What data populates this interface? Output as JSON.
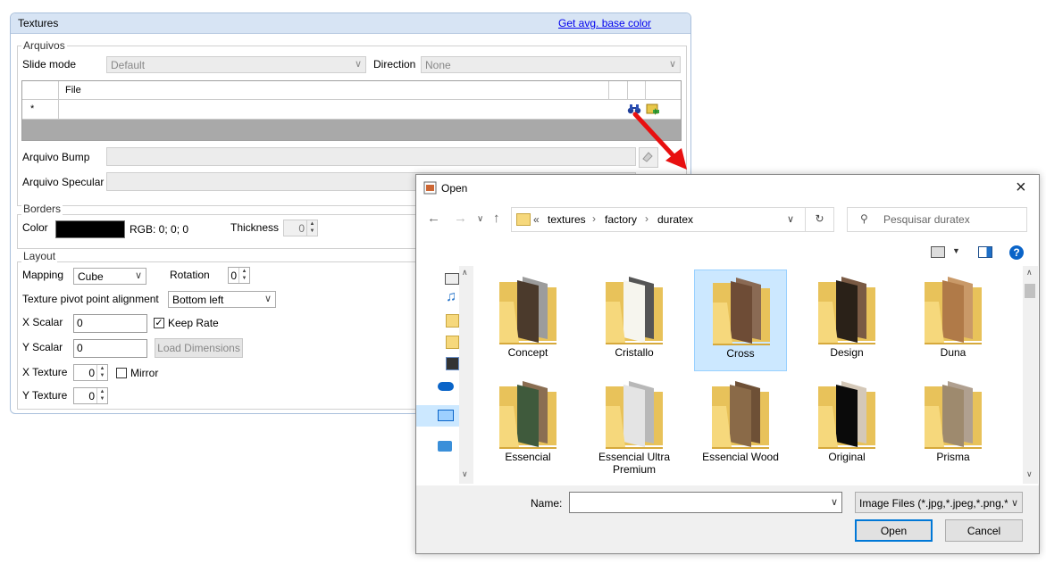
{
  "textures": {
    "title": "Textures",
    "avg_link": "Get avg. base color",
    "arquivos": {
      "group_label": "Arquivos",
      "slide_mode_label": "Slide mode",
      "slide_mode_value": "Default",
      "direction_label": "Direction",
      "direction_value": "None",
      "grid": {
        "col_file": "File",
        "new_row_marker": "*"
      },
      "bump_label": "Arquivo Bump",
      "specular_label": "Arquivo Specular"
    },
    "borders": {
      "group_label": "Borders",
      "color_label": "Color",
      "color_swatch": "#000000",
      "rgb_text": "RGB: 0; 0; 0",
      "thickness_label": "Thickness",
      "thickness_value": "0"
    },
    "layout": {
      "group_label": "Layout",
      "mapping_label": "Mapping",
      "mapping_value": "Cube",
      "rotation_label": "Rotation",
      "rotation_value": "0",
      "pivot_label": "Texture pivot point alignment",
      "pivot_value": "Bottom left",
      "xscalar_label": "X Scalar",
      "xscalar_value": "0",
      "keep_rate_label": "Keep Rate",
      "yscalar_label": "Y Scalar",
      "yscalar_value": "0",
      "load_dims_label": "Load Dimensions",
      "xtexture_label": "X Texture",
      "xtexture_value": "0",
      "mirror_label": "Mirror",
      "ytexture_label": "Y Texture",
      "ytexture_value": "0"
    }
  },
  "dialog": {
    "title": "Open",
    "breadcrumb": [
      "textures",
      "factory",
      "duratex"
    ],
    "breadcrumb_prefix": "«",
    "search_placeholder": "Pesquisar duratex",
    "folders": [
      {
        "name": "Concept",
        "colors": [
          "#4b3a2c",
          "#9c9c9c"
        ]
      },
      {
        "name": "Cristallo",
        "colors": [
          "#f6f5ee",
          "#555555"
        ]
      },
      {
        "name": "Cross",
        "colors": [
          "#6e4c36",
          "#8a6a54"
        ],
        "selected": true
      },
      {
        "name": "Design",
        "colors": [
          "#2a2118",
          "#7a5a44"
        ]
      },
      {
        "name": "Duna",
        "colors": [
          "#b07a48",
          "#c99968"
        ]
      },
      {
        "name": "Essencial",
        "colors": [
          "#3f5a3c",
          "#8a6e52"
        ]
      },
      {
        "name": "Essencial Ultra Premium",
        "colors": [
          "#e4e4e4",
          "#b8b8b8"
        ]
      },
      {
        "name": "Essencial Wood",
        "colors": [
          "#8a6a48",
          "#6e5036"
        ]
      },
      {
        "name": "Original",
        "colors": [
          "#0a0a0a",
          "#d4c8b8"
        ]
      },
      {
        "name": "Prisma",
        "colors": [
          "#9e8a6e",
          "#b0a090"
        ]
      }
    ],
    "name_label": "Name:",
    "name_value": "",
    "filter_value": "Image Files (*.jpg,*.jpeg,*.png,*",
    "open_button": "Open",
    "cancel_button": "Cancel"
  },
  "colors": {
    "arrow": "#e81010",
    "accent": "#0078d7"
  }
}
